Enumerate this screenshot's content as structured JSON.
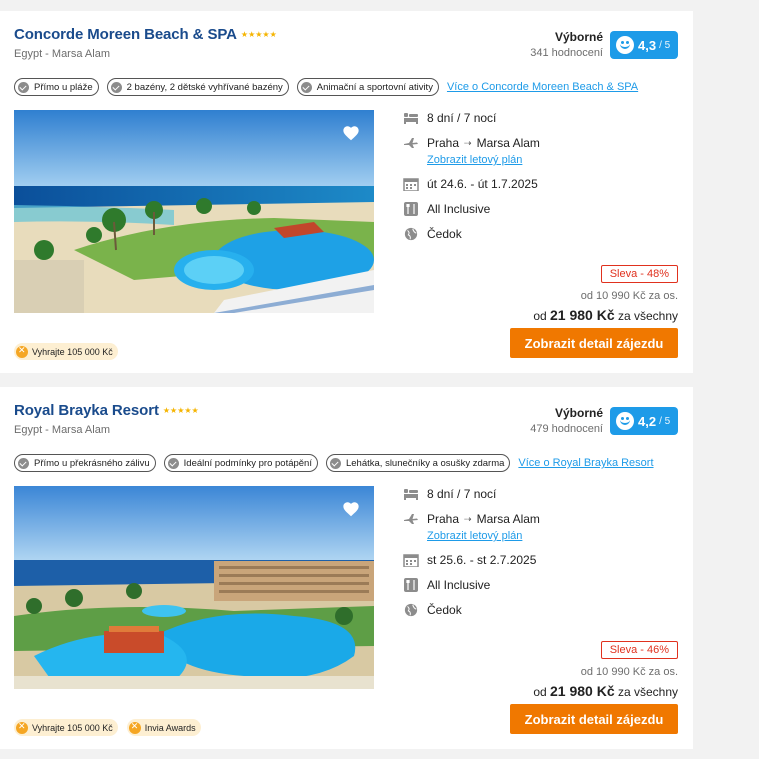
{
  "cards": [
    {
      "name": "Concorde Moreen Beach & SPA",
      "stars": 5,
      "location": "Egypt - Marsa Alam",
      "rating_word": "Výborné",
      "rating_count": "341 hodnocení",
      "rating_score": "4,3",
      "rating_max": "/ 5",
      "tags": [
        "Přímo u pláže",
        "2 bazény, 2 dětské vyhřívané bazény",
        "Animační a sportovní ativity"
      ],
      "more_link": "Více o Concorde Moreen Beach & SPA",
      "duration": "8 dní / 7 nocí",
      "from": "Praha",
      "to": "Marsa Alam",
      "flight_link": "Zobrazit letový plán",
      "dates": "út 24.6. - út 1.7.2025",
      "board": "All Inclusive",
      "operator": "Čedok",
      "discount": "Sleva - 48%",
      "price_per_person": "od 10 990 Kč za os.",
      "price_prefix": "od",
      "price_total": "21 980 Kč",
      "price_suffix": "za všechny",
      "cta": "Zobrazit detail zájezdu",
      "badges": [
        "Vyhrajte 105 000 Kč"
      ]
    },
    {
      "name": "Royal Brayka Resort",
      "stars": 5,
      "location": "Egypt - Marsa Alam",
      "rating_word": "Výborné",
      "rating_count": "479 hodnocení",
      "rating_score": "4,2",
      "rating_max": "/ 5",
      "tags": [
        "Přímo u překrásného zálivu",
        "Ideální podmínky pro potápění",
        "Lehátka, slunečníky a osušky zdarma"
      ],
      "more_link": "Více o Royal Brayka Resort",
      "duration": "8 dní / 7 nocí",
      "from": "Praha",
      "to": "Marsa Alam",
      "flight_link": "Zobrazit letový plán",
      "dates": "st 25.6. - st 2.7.2025",
      "board": "All Inclusive",
      "operator": "Čedok",
      "discount": "Sleva - 46%",
      "price_per_person": "od 10 990 Kč za os.",
      "price_prefix": "od",
      "price_total": "21 980 Kč",
      "price_suffix": "za všechny",
      "cta": "Zobrazit detail zájezdu",
      "badges": [
        "Vyhrajte 105 000 Kč",
        "Invia Awards"
      ]
    }
  ],
  "icons": {
    "star": "star-icon",
    "heart": "heart-icon",
    "bed": "bed-icon",
    "plane": "plane-icon",
    "calendar": "calendar-icon",
    "meal": "cutlery-icon",
    "operator": "globe-icon",
    "check": "check-icon",
    "award": "award-icon",
    "smile": "smile-icon"
  },
  "colors": {
    "title": "#1a4b8c",
    "link": "#1e9be8",
    "rating_badge": "#1e9be8",
    "cta": "#f07800",
    "discount": "#e0311e",
    "star": "#f5b400",
    "badge_bg": "#fdefd2"
  }
}
